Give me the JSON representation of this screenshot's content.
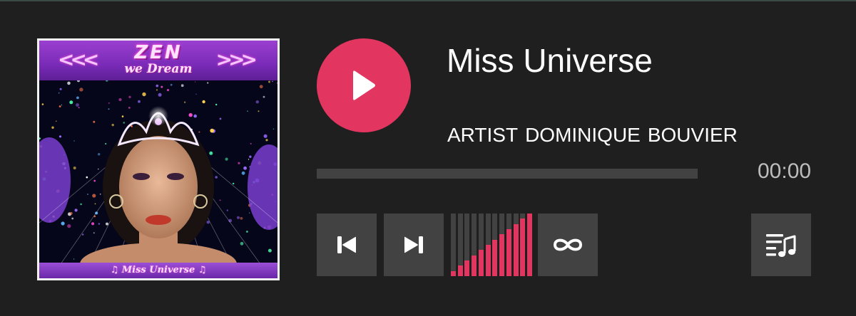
{
  "cover": {
    "title": "ZEN",
    "subtitle": "we Dream",
    "footer": "♫ Miss Universe ♫",
    "chevrons_left": "<<<",
    "chevrons_right": ">>>"
  },
  "track": {
    "title": "Miss Universe",
    "artist_label": "ARTIST",
    "artist_first": "DOMINIQUE",
    "artist_last": "BOUVIER"
  },
  "playback": {
    "time": "00:00",
    "progress_fraction": 0,
    "state": "paused"
  },
  "volume": {
    "bar_count": 12,
    "level_fraction": 1.0
  },
  "controls": {
    "play_icon": "play-icon",
    "prev_icon": "skip-previous-icon",
    "next_icon": "skip-next-icon",
    "loop_icon": "loop-icon",
    "playlist_icon": "playlist-music-icon"
  },
  "colors": {
    "accent": "#e23560",
    "background": "#1f1f1f",
    "button": "#424242",
    "text": "#ffffff",
    "muted_text": "#bdbdbd"
  }
}
